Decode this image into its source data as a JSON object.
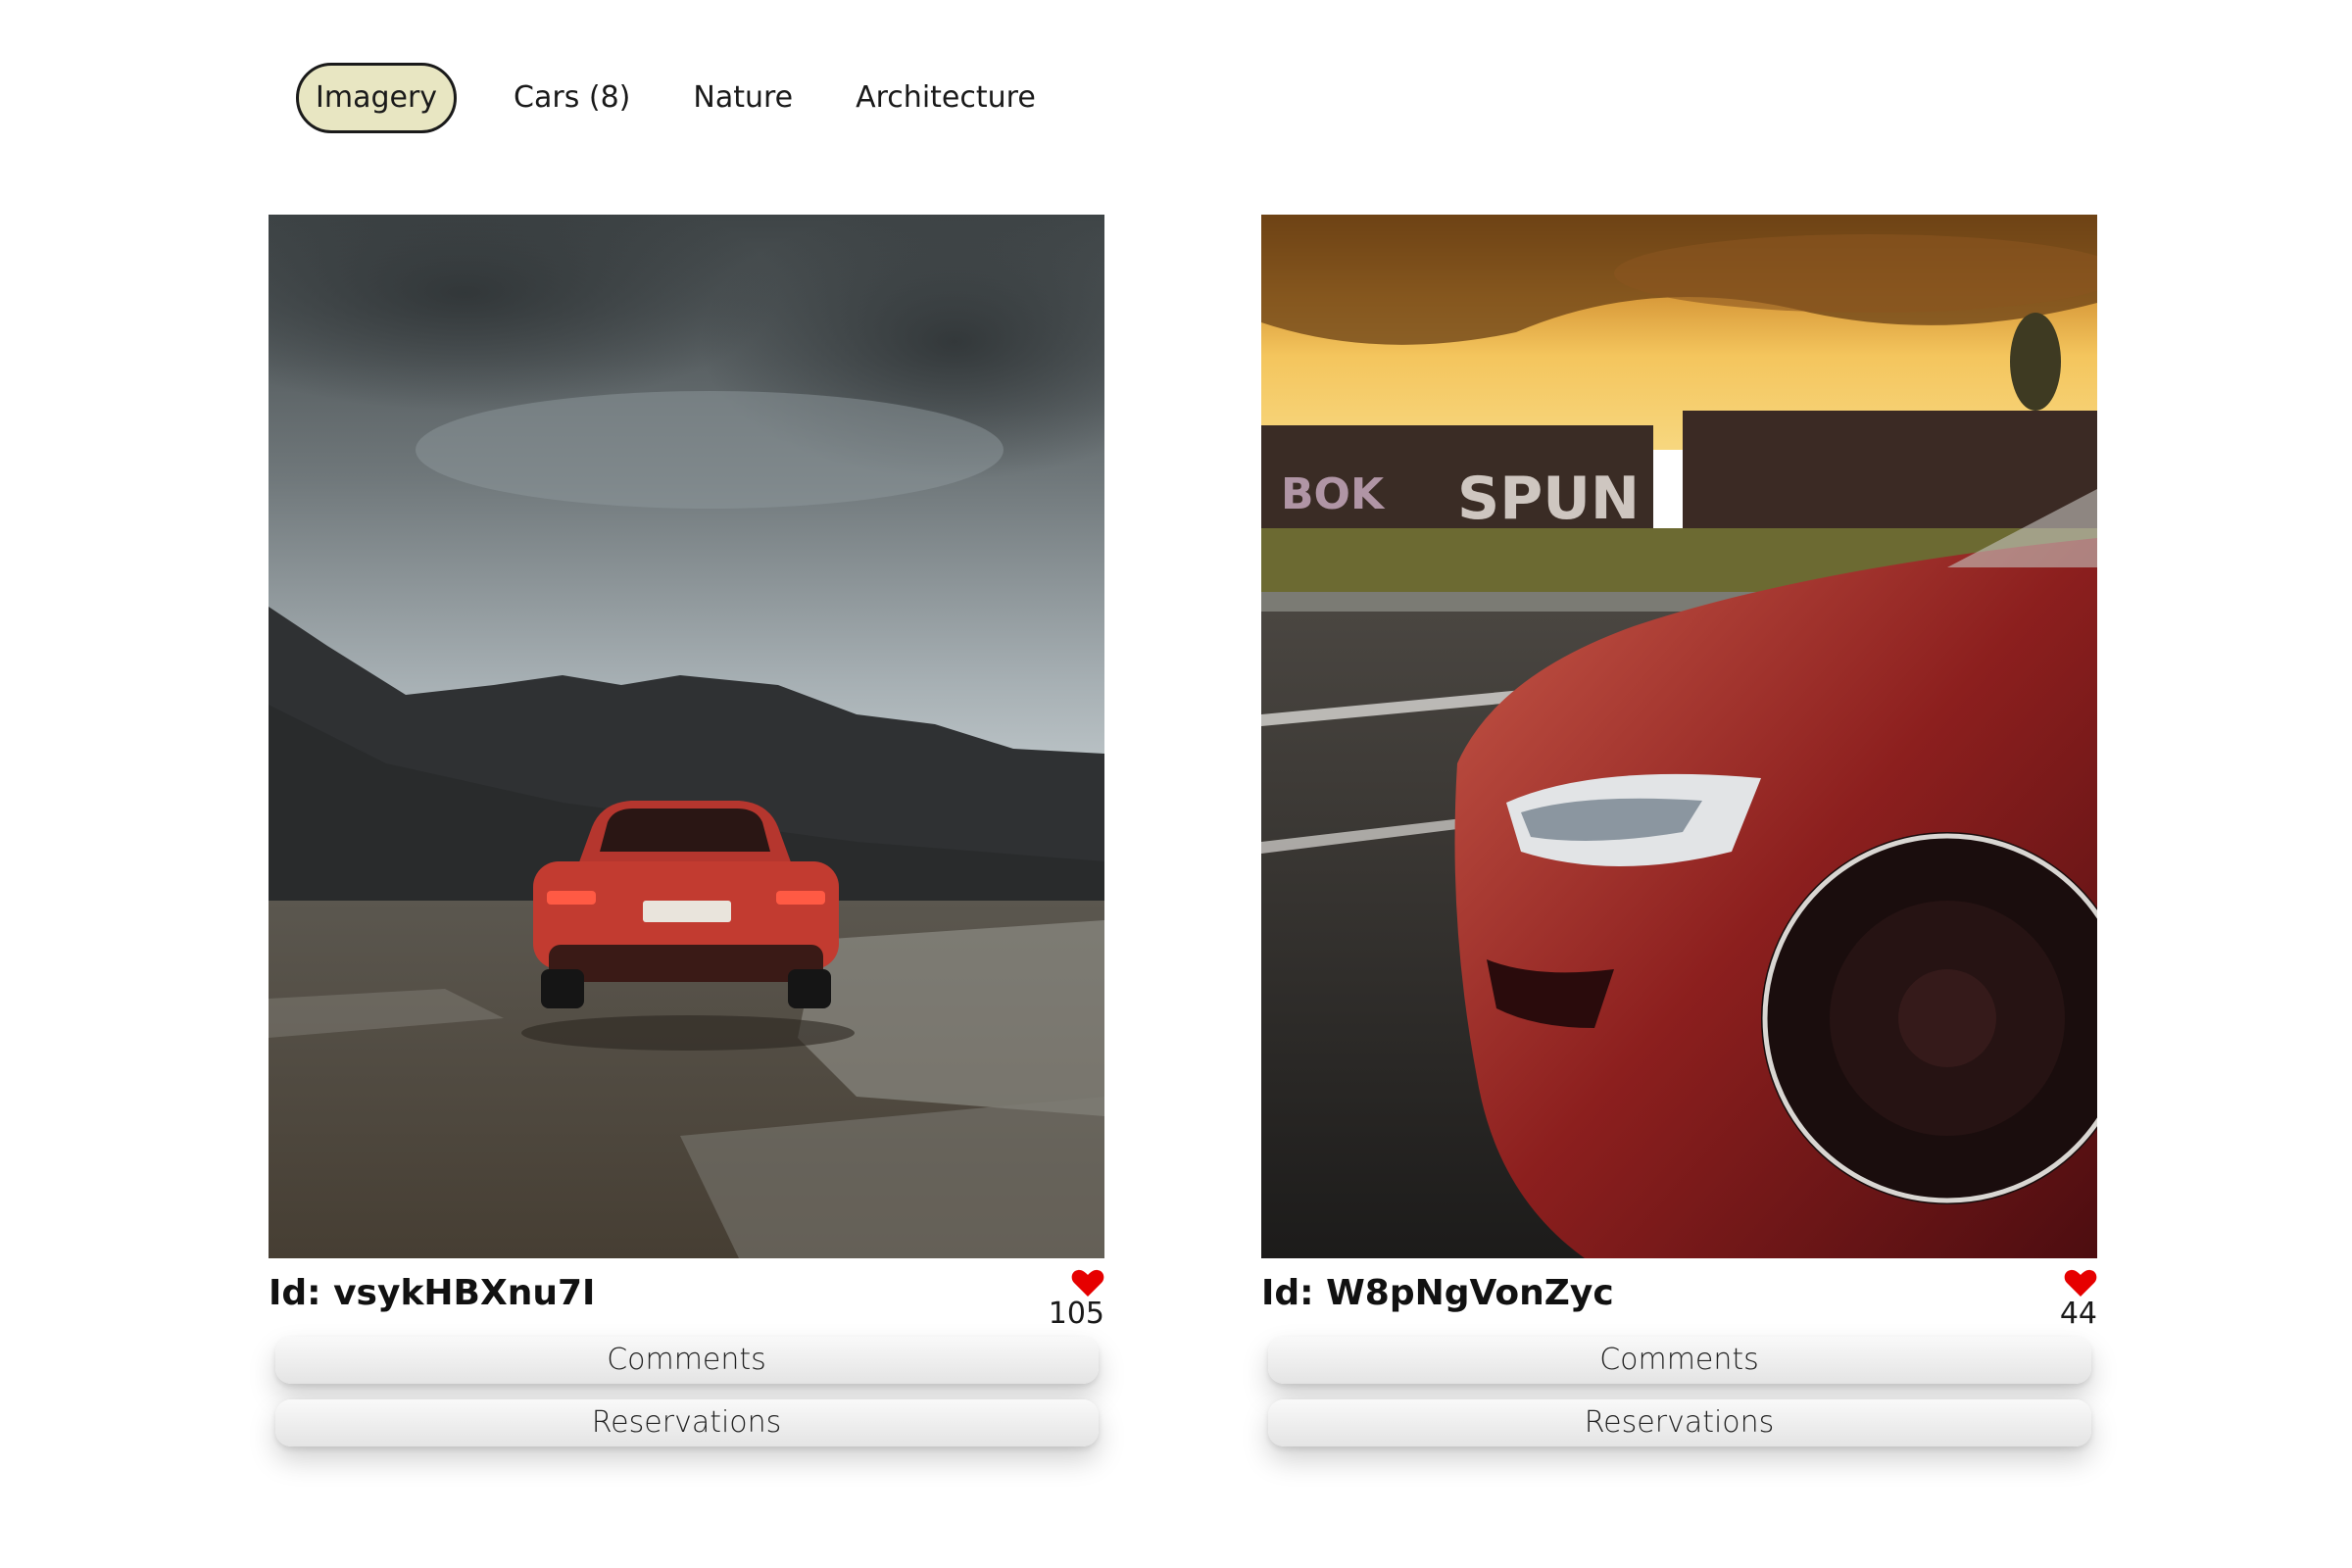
{
  "nav": {
    "items": [
      {
        "label": "Imagery",
        "active": true
      },
      {
        "label": "Cars (8)",
        "active": false
      },
      {
        "label": "Nature",
        "active": false
      },
      {
        "label": "Architecture",
        "active": false
      }
    ]
  },
  "cards": [
    {
      "id_label": "Id: vsykHBXnu7I",
      "likes": "105",
      "comments_label": "Comments",
      "reservations_label": "Reservations",
      "image_subject": "red car parked by dark gravel hill under cloudy sky"
    },
    {
      "id_label": "Id: W8pNgVonZyc",
      "likes": "44",
      "comments_label": "Comments",
      "reservations_label": "Reservations",
      "image_subject": "red car front on highway at sunset with graffiti train"
    }
  ],
  "colors": {
    "active_tab_bg": "#e8e6c2",
    "heart": "#e60000",
    "button_bg": "#eeeeee"
  },
  "icons": {
    "like": "heart-icon"
  }
}
